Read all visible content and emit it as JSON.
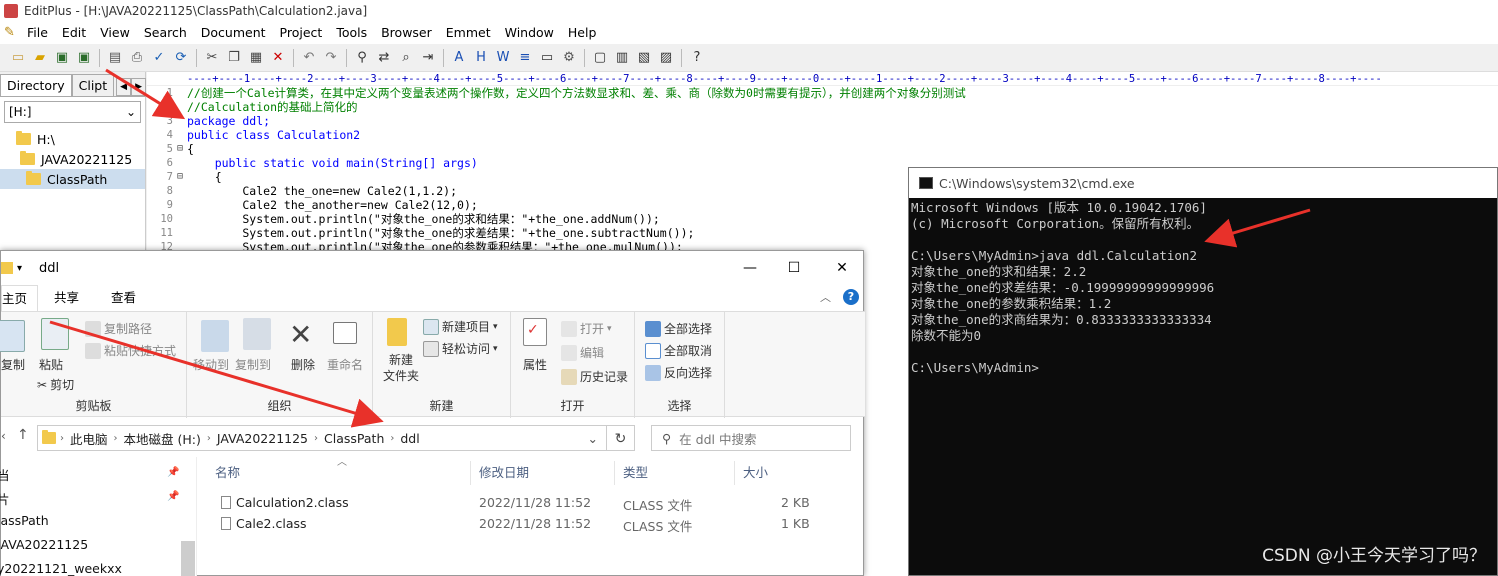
{
  "editplus": {
    "title": "EditPlus - [H:\\JAVA20221125\\ClassPath\\Calculation2.java]",
    "menu": [
      "File",
      "Edit",
      "View",
      "Search",
      "Document",
      "Project",
      "Tools",
      "Browser",
      "Emmet",
      "Window",
      "Help"
    ],
    "sidebar": {
      "tab_directory": "Directory",
      "tab_clip": "Clipt",
      "drive": "[H:]",
      "tree": [
        "H:\\",
        "JAVA20221125",
        "ClassPath"
      ]
    },
    "ruler": "----+----1----+----2----+----3----+----4----+----5----+----6----+----7----+----8----+----9----+----0----+----1----+----2----+----3----+----4----+----5----+----6----+----7----+----8----+----",
    "code": [
      {
        "n": "1",
        "fold": "",
        "cls": "c-cmt",
        "text": "//创建一个Cale计算类，在其中定义两个变量表述两个操作数，定义四个方法数显求和、差、乘、商（除数为0时需要有提示），并创建两个对象分别测试"
      },
      {
        "n": "2",
        "fold": "",
        "cls": "c-cmt",
        "text": "//Calculation的基础上简化的"
      },
      {
        "n": "3",
        "fold": "",
        "cls": "c-kw",
        "text": "package ddl;"
      },
      {
        "n": "4",
        "fold": "",
        "cls": "c-kw",
        "text": "public class Calculation2"
      },
      {
        "n": "5",
        "fold": "⊟",
        "cls": "",
        "text": "{"
      },
      {
        "n": "6",
        "fold": "",
        "cls": "c-kw",
        "text": "    public static void main(String[] args)"
      },
      {
        "n": "7",
        "fold": "⊟",
        "cls": "",
        "text": "    {"
      },
      {
        "n": "8",
        "fold": "",
        "cls": "",
        "text": "        Cale2 the_one=new Cale2(1,1.2);"
      },
      {
        "n": "9",
        "fold": "",
        "cls": "",
        "text": "        Cale2 the_another=new Cale2(12,0);"
      },
      {
        "n": "10",
        "fold": "",
        "cls": "",
        "text": "        System.out.println(\"对象the_one的求和结果：\"+the_one.addNum());"
      },
      {
        "n": "11",
        "fold": "",
        "cls": "",
        "text": "        System.out.println(\"对象the_one的求差结果：\"+the_one.subtractNum());"
      },
      {
        "n": "12",
        "fold": "",
        "cls": "",
        "text": "        System.out.println(\"对象the_one的参数乘积结果：\"+the_one.mulNum());"
      }
    ]
  },
  "explorer": {
    "title": "ddl",
    "tabs": [
      "主页",
      "共享",
      "查看"
    ],
    "ribbon": {
      "copy": "复制",
      "paste": "粘贴",
      "copy_path": "复制路径",
      "paste_shortcut": "粘贴快捷方式",
      "cut": "剪切",
      "group_clipboard": "剪贴板",
      "move_to": "移动到",
      "copy_to": "复制到",
      "delete": "删除",
      "rename": "重命名",
      "group_organize": "组织",
      "new_folder_l1": "新建",
      "new_folder_l2": "文件夹",
      "new_item": "新建项目",
      "easy_access": "轻松访问",
      "group_new": "新建",
      "properties": "属性",
      "open": "打开",
      "edit": "编辑",
      "history": "历史记录",
      "group_open": "打开",
      "select_all": "全部选择",
      "select_none": "全部取消",
      "invert": "反向选择",
      "group_select": "选择"
    },
    "address": [
      "此电脑",
      "本地磁盘 (H:)",
      "JAVA20221125",
      "ClassPath",
      "ddl"
    ],
    "search_placeholder": "在 ddl 中搜索",
    "nav": [
      "当",
      "片",
      "lassPath",
      "JAVA20221125",
      "y20221121_weekxx"
    ],
    "columns": {
      "name": "名称",
      "date": "修改日期",
      "type": "类型",
      "size": "大小"
    },
    "files": [
      {
        "name": "Calculation2.class",
        "date": "2022/11/28 11:52",
        "type": "CLASS 文件",
        "size": "2 KB"
      },
      {
        "name": "Cale2.class",
        "date": "2022/11/28 11:52",
        "type": "CLASS 文件",
        "size": "1 KB"
      }
    ]
  },
  "cmd": {
    "title": "C:\\Windows\\system32\\cmd.exe",
    "lines": [
      "Microsoft Windows [版本 10.0.19042.1706]",
      "(c) Microsoft Corporation。保留所有权利。",
      "",
      "C:\\Users\\MyAdmin>java ddl.Calculation2",
      "对象the_one的求和结果：2.2",
      "对象the_one的求差结果：-0.19999999999999996",
      "对象the_one的参数乘积结果：1.2",
      "对象the_one的求商结果为：0.8333333333333334",
      "除数不能为0",
      "",
      "C:\\Users\\MyAdmin>"
    ]
  },
  "watermark": "CSDN @小王今天学习了吗？",
  "colors": {
    "arrow": "#e8312a",
    "cmd_bg": "#0c0c0c",
    "folder": "#f2c94c"
  }
}
